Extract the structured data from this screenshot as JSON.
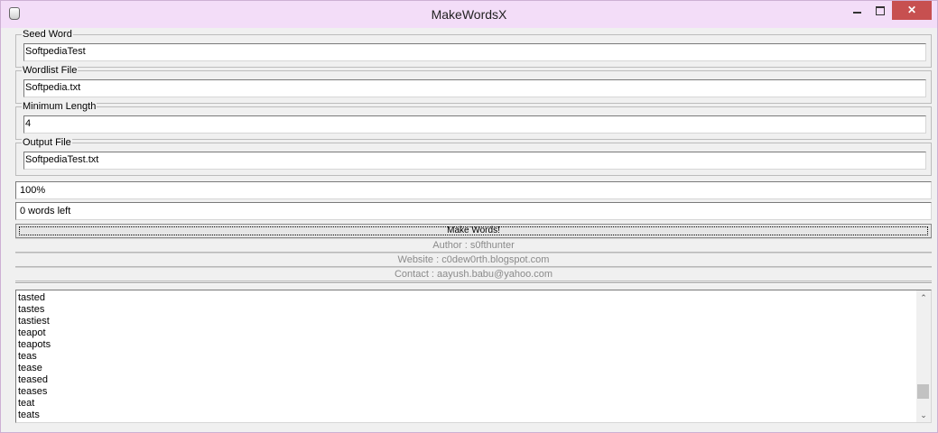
{
  "window": {
    "title": "MakeWordsX"
  },
  "titlebar": {
    "icon": "app-icon",
    "minimize_icon": "minimize-icon",
    "maximize_icon": "maximize-icon",
    "close_glyph": "✕"
  },
  "seed_word": {
    "label": "Seed Word",
    "value": "SoftpediaTest"
  },
  "wordlist_file": {
    "label": "Wordlist File",
    "value": "Softpedia.txt"
  },
  "minimum_length": {
    "label": "Minimum Length",
    "value": "4"
  },
  "output_file": {
    "label": "Output File",
    "value": "SoftpediaTest.txt"
  },
  "progress": {
    "text": "100%"
  },
  "words_left": {
    "text": "0 words left"
  },
  "make_button": {
    "label": "Make Words!"
  },
  "info": {
    "author": "Author : s0fthunter",
    "website": "Website : c0dew0rth.blogspot.com",
    "contact": "Contact : aayush.babu@yahoo.com"
  },
  "results": {
    "items": [
      "tasted",
      "tastes",
      "tastiest",
      "teapot",
      "teapots",
      "teas",
      "tease",
      "teased",
      "teases",
      "teat",
      "teats"
    ]
  },
  "scrollbar": {
    "up_glyph": "⌃",
    "down_glyph": "⌄"
  }
}
